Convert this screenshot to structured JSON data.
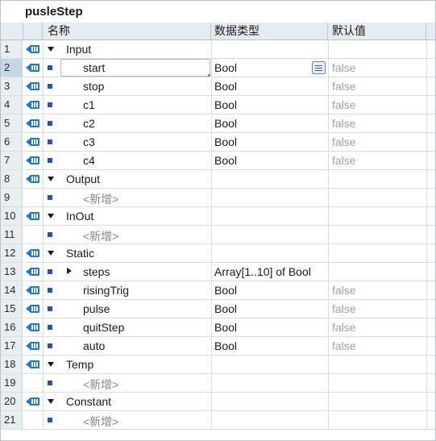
{
  "block": {
    "title": "pusleStep"
  },
  "columns": {
    "name": "名称",
    "datatype": "数据类型",
    "default": "默认值"
  },
  "rows": [
    {
      "num": "1",
      "kind": "group",
      "name": "Input",
      "type": "",
      "default": ""
    },
    {
      "num": "2",
      "kind": "member",
      "name": "start",
      "type": "Bool",
      "default": "false",
      "selected": true
    },
    {
      "num": "3",
      "kind": "member",
      "name": "stop",
      "type": "Bool",
      "default": "false"
    },
    {
      "num": "4",
      "kind": "member",
      "name": "c1",
      "type": "Bool",
      "default": "false"
    },
    {
      "num": "5",
      "kind": "member",
      "name": "c2",
      "type": "Bool",
      "default": "false"
    },
    {
      "num": "6",
      "kind": "member",
      "name": "c3",
      "type": "Bool",
      "default": "false"
    },
    {
      "num": "7",
      "kind": "member",
      "name": "c4",
      "type": "Bool",
      "default": "false"
    },
    {
      "num": "8",
      "kind": "group",
      "name": "Output",
      "type": "",
      "default": ""
    },
    {
      "num": "9",
      "kind": "add",
      "name": "<新增>",
      "type": "",
      "default": ""
    },
    {
      "num": "10",
      "kind": "group",
      "name": "InOut",
      "type": "",
      "default": ""
    },
    {
      "num": "11",
      "kind": "add",
      "name": "<新增>",
      "type": "",
      "default": ""
    },
    {
      "num": "12",
      "kind": "group",
      "name": "Static",
      "type": "",
      "default": ""
    },
    {
      "num": "13",
      "kind": "array",
      "name": "steps",
      "type": "Array[1..10] of Bool",
      "default": ""
    },
    {
      "num": "14",
      "kind": "member",
      "name": "risingTrig",
      "type": "Bool",
      "default": "false"
    },
    {
      "num": "15",
      "kind": "member",
      "name": "pulse",
      "type": "Bool",
      "default": "false"
    },
    {
      "num": "16",
      "kind": "member",
      "name": "quitStep",
      "type": "Bool",
      "default": "false"
    },
    {
      "num": "17",
      "kind": "member",
      "name": "auto",
      "type": "Bool",
      "default": "false"
    },
    {
      "num": "18",
      "kind": "group",
      "name": "Temp",
      "type": "",
      "default": ""
    },
    {
      "num": "19",
      "kind": "add",
      "name": "<新增>",
      "type": "",
      "default": ""
    },
    {
      "num": "20",
      "kind": "group",
      "name": "Constant",
      "type": "",
      "default": ""
    },
    {
      "num": "21",
      "kind": "add",
      "name": "<新增>",
      "type": "",
      "default": ""
    }
  ],
  "icons": {
    "interface": "interface-db-icon",
    "member": "member-bullet-icon",
    "expand": "expand-triangle-icon",
    "collapsed": "collapsed-triangle-icon",
    "picker": "type-picker-icon"
  },
  "colors": {
    "accent": "#2e4fb0",
    "icon_blue": "#1f79c4",
    "row_number_bg": "#e9edf0",
    "header_bg": "#e6ebef",
    "default_text": "#9aa3ab"
  }
}
